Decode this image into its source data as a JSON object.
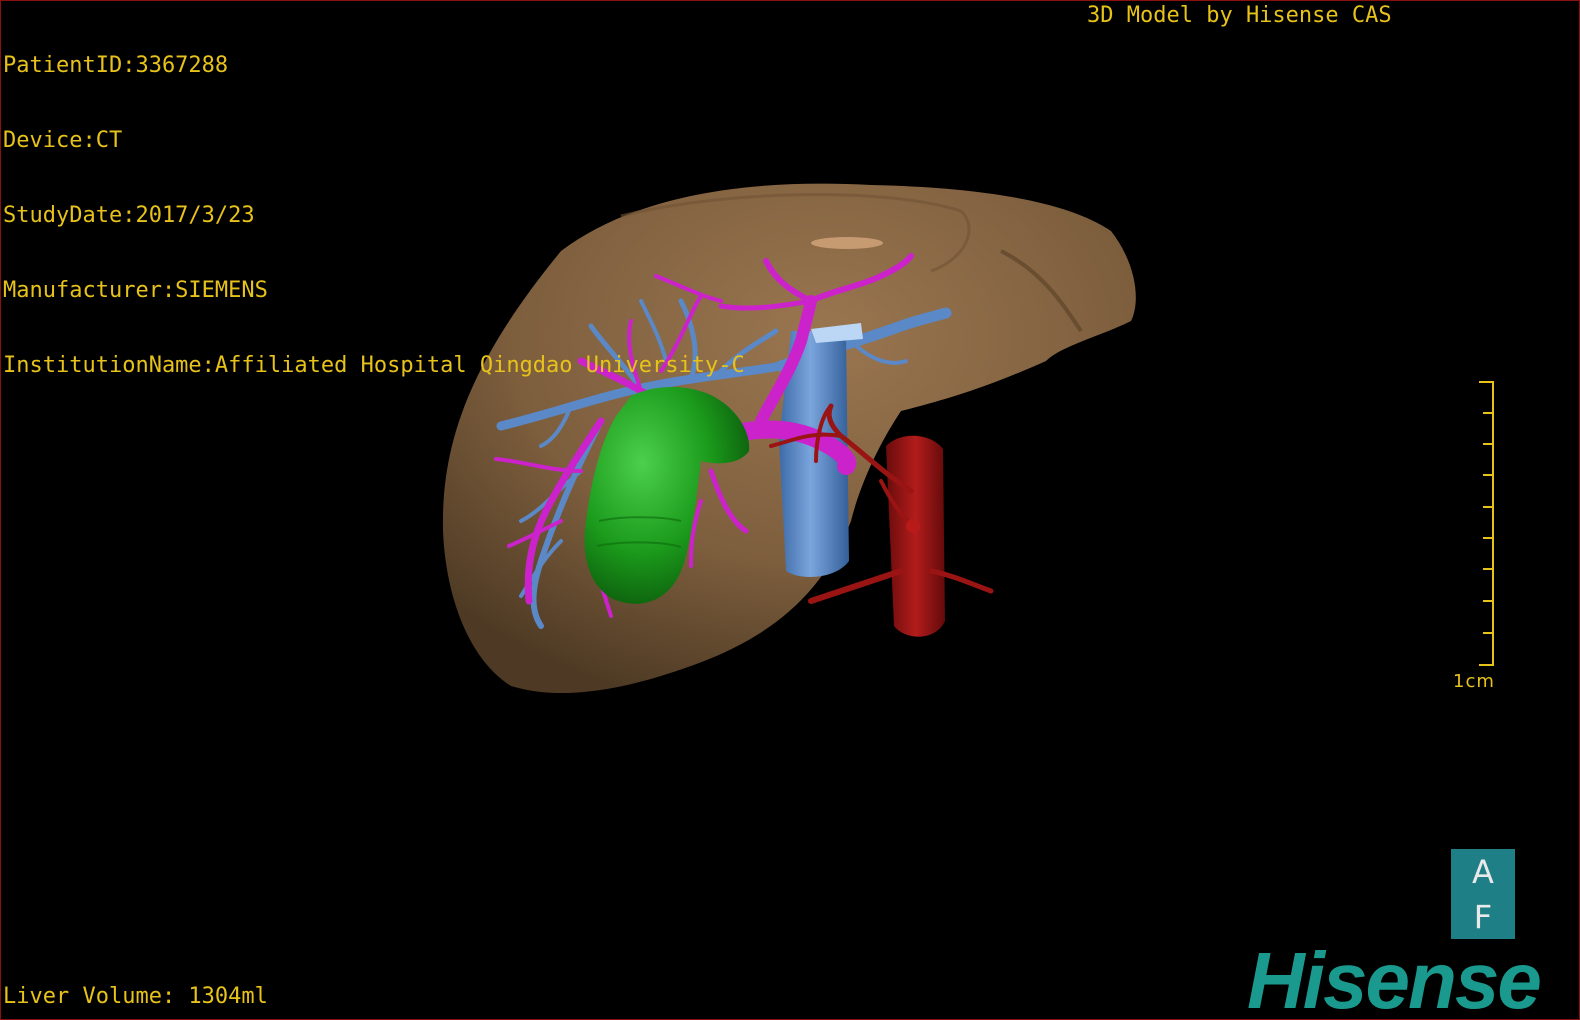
{
  "window": {
    "border_color": "#8a1010",
    "background": "#000000"
  },
  "overlay": {
    "text_color": "#e7c21a",
    "patient_id": "PatientID:3367288",
    "device": "Device:CT",
    "study_date": "StudyDate:2017/3/23",
    "manufacturer": "Manufacturer:SIEMENS",
    "institution": "InstitutionName:Affiliated Hospital Qingdao University-C",
    "credit": "3D Model by Hisense CAS",
    "liver_volume": "Liver Volume: 1304ml"
  },
  "scale": {
    "label": "1cm",
    "ticks": 10
  },
  "orientation": {
    "top": "A",
    "bottom": "F",
    "color": "#1e7f86"
  },
  "brand": {
    "name": "Hisense",
    "color": "#1a9a8e"
  },
  "structures": {
    "liver": "#8c6a45",
    "portal_vein": "#cc22cc",
    "hepatic_vein": "#5b88c6",
    "gallbladder_tumor": "#1a9a1a",
    "ivc": "#5b88c6",
    "artery": "#9a1414"
  }
}
